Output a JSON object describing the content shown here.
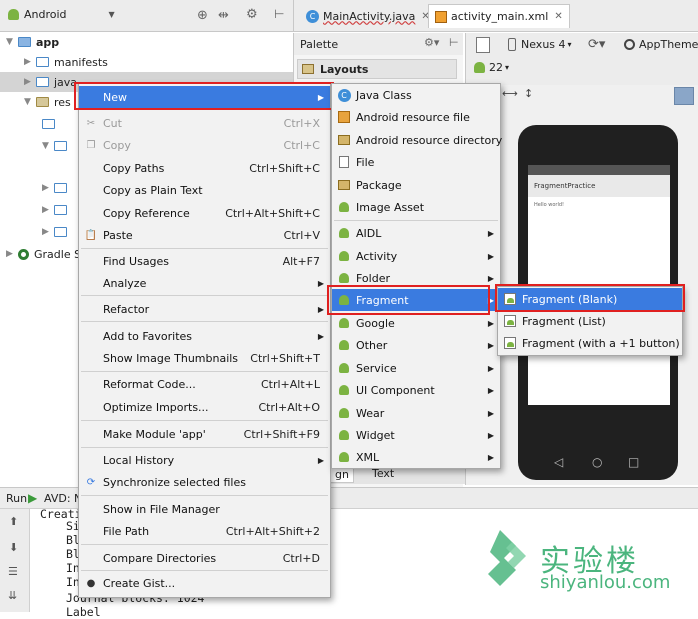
{
  "project_panel": {
    "view_selector": "Android",
    "tree": [
      {
        "label": "app"
      },
      {
        "label": "manifests"
      },
      {
        "label": "java"
      },
      {
        "label": "res"
      },
      {
        "label": "Gradle S"
      }
    ]
  },
  "editor_tabs": [
    {
      "label": "MainActivity.java"
    },
    {
      "label": "activity_main.xml"
    }
  ],
  "palette": {
    "title": "Palette",
    "group": "Layouts"
  },
  "design_toolbar": {
    "device": "Nexus 4",
    "theme": "AppTheme",
    "api": "22"
  },
  "design_tabs": [
    "gn",
    "Text"
  ],
  "phone_preview": {
    "app_title": "FragmentPractice",
    "body_text": "Hello world!"
  },
  "run_panel": {
    "label": "Run",
    "config": "AVD: Ne",
    "console": [
      "Creati",
      "Si",
      "Bl",
      "Bl",
      "In",
      "In",
      "Journal blocks: 1024",
      "Label"
    ]
  },
  "context_menu": {
    "items": [
      {
        "label": "New",
        "shortcut": "",
        "submenu": true
      },
      {
        "label": "Cut",
        "shortcut": "Ctrl+X"
      },
      {
        "label": "Copy",
        "shortcut": "Ctrl+C"
      },
      {
        "label": "Copy Paths",
        "shortcut": "Ctrl+Shift+C"
      },
      {
        "label": "Copy as Plain Text",
        "shortcut": ""
      },
      {
        "label": "Copy Reference",
        "shortcut": "Ctrl+Alt+Shift+C"
      },
      {
        "label": "Paste",
        "shortcut": "Ctrl+V"
      },
      {
        "label": "Find Usages",
        "shortcut": "Alt+F7"
      },
      {
        "label": "Analyze",
        "shortcut": ""
      },
      {
        "label": "Refactor",
        "shortcut": ""
      },
      {
        "label": "Add to Favorites",
        "shortcut": ""
      },
      {
        "label": "Show Image Thumbnails",
        "shortcut": "Ctrl+Shift+T"
      },
      {
        "label": "Reformat Code...",
        "shortcut": "Ctrl+Alt+L"
      },
      {
        "label": "Optimize Imports...",
        "shortcut": "Ctrl+Alt+O"
      },
      {
        "label": "Make Module 'app'",
        "shortcut": "Ctrl+Shift+F9"
      },
      {
        "label": "Local History",
        "shortcut": ""
      },
      {
        "label": "Synchronize selected files",
        "shortcut": ""
      },
      {
        "label": "Show in File Manager",
        "shortcut": ""
      },
      {
        "label": "File Path",
        "shortcut": "Ctrl+Alt+Shift+2"
      },
      {
        "label": "Compare Directories",
        "shortcut": "Ctrl+D"
      },
      {
        "label": "Create Gist...",
        "shortcut": ""
      }
    ]
  },
  "new_submenu": {
    "items": [
      {
        "label": "Java Class"
      },
      {
        "label": "Android resource file"
      },
      {
        "label": "Android resource directory"
      },
      {
        "label": "File"
      },
      {
        "label": "Package"
      },
      {
        "label": "Image Asset"
      },
      {
        "label": "AIDL"
      },
      {
        "label": "Activity"
      },
      {
        "label": "Folder"
      },
      {
        "label": "Fragment"
      },
      {
        "label": "Google"
      },
      {
        "label": "Other"
      },
      {
        "label": "Service"
      },
      {
        "label": "UI Component"
      },
      {
        "label": "Wear"
      },
      {
        "label": "Widget"
      },
      {
        "label": "XML"
      }
    ]
  },
  "fragment_submenu": {
    "items": [
      {
        "label": "Fragment (Blank)"
      },
      {
        "label": "Fragment (List)"
      },
      {
        "label": "Fragment (with a +1 button)"
      }
    ]
  },
  "watermark": {
    "text": "实验楼",
    "url": "shiyanlou.com"
  },
  "colors": {
    "highlight": "#3a7be0",
    "callout_border": "#e02020",
    "android_green": "#7cb342",
    "watermark": "#4bb57e"
  }
}
